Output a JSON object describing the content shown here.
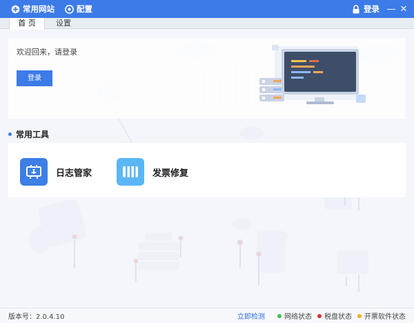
{
  "titlebar": {
    "common_sites": "常用网站",
    "config": "配置",
    "login": "登录",
    "minimize": "—",
    "close": "✕",
    "accent": "#3c7be8"
  },
  "tabs": [
    {
      "label": "首 页",
      "active": true
    },
    {
      "label": "设置",
      "active": false
    }
  ],
  "welcome": {
    "text": "欢迎回来，请登录",
    "login_button": "登录"
  },
  "tools": {
    "title": "常用工具",
    "items": [
      {
        "label": "日志管家",
        "icon": "log-manager-icon",
        "color": "#3d7fe6"
      },
      {
        "label": "发票修复",
        "icon": "invoice-repair-icon",
        "color": "#5ab6f5"
      }
    ]
  },
  "statusbar": {
    "version": "版本号：2.0.4.10",
    "check_now": "立即检测",
    "statuses": [
      {
        "label": "网络状态",
        "color": "#3cc34a"
      },
      {
        "label": "税盘状态",
        "color": "#e0302a"
      },
      {
        "label": "开票软件状态",
        "color": "#f2b01e"
      }
    ]
  }
}
